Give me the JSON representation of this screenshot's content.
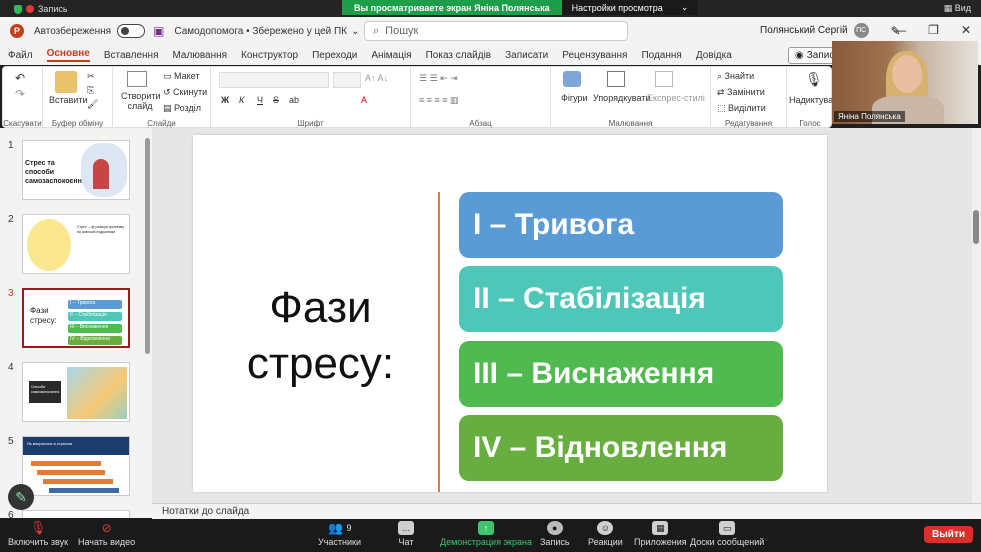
{
  "zoom_top": {
    "record_label": "Запись",
    "banner_text": "Вы просматриваете экран Яніна Полянська",
    "view_options_label": "Настройки просмотра",
    "view_label": "Вид"
  },
  "titlebar": {
    "autosave_label": "Автозбереження",
    "doc_title": "Самодопомога • Збережено у цей ПК",
    "doc_chevron": "⌄",
    "search_placeholder": "Пошук",
    "user_name": "Полянський Сергій",
    "user_initials": "ПС"
  },
  "tabs": [
    "Файл",
    "Основне",
    "Вставлення",
    "Малювання",
    "Конструктор",
    "Переходи",
    "Анімація",
    "Показ слайдів",
    "Записати",
    "Рецензування",
    "Подання",
    "Довідка"
  ],
  "record_button": "Записа",
  "ribbon": {
    "groups": [
      "Скасувати",
      "Буфер обміну",
      "Слайди",
      "Шрифт",
      "Абзац",
      "Малювання",
      "Редагування",
      "Голос"
    ],
    "paste": "Вставити",
    "new_slide": "Створити слайд",
    "layout": "Макет",
    "reset": "Скинути",
    "section": "Розділ",
    "shapes": "Фігури",
    "arrange": "Упорядкувати",
    "quick_styles": "Експрес-стилі",
    "find": "Знайти",
    "replace": "Замінити",
    "select": "Виділити",
    "dictate": "Надиктувати",
    "font_buttons": [
      "Ж",
      "К",
      "Ч",
      "S",
      "ab"
    ]
  },
  "camera": {
    "name": "Яніна Полянська"
  },
  "slides": [
    {
      "num": "1",
      "title": "Стрес та способи самозаспокоєння"
    },
    {
      "num": "2",
      "title": "Стрес – це реакція організму на зовнішні подразники"
    },
    {
      "num": "3",
      "title": "Фази стресу:",
      "items": [
        "I – Тривога",
        "II – Стабілізація",
        "III – Виснаження",
        "IV – Відновлення"
      ]
    },
    {
      "num": "4",
      "title": "Способи самозаспокоєння"
    },
    {
      "num": "5",
      "title": "Як впоратися зі стресом"
    },
    {
      "num": "6",
      "title": ""
    }
  ],
  "current_slide": {
    "title_line1": "Фази",
    "title_line2": "стресу:",
    "phases": [
      {
        "label": "I – Тривога",
        "color": "#5b9bd5"
      },
      {
        "label": "II – Стабілізація",
        "color": "#4fc7b8"
      },
      {
        "label": "III – Виснаження",
        "color": "#50b94f"
      },
      {
        "label": "IV – Відновлення",
        "color": "#68ad3f"
      }
    ],
    "divider_color": "#e07b39"
  },
  "notes_placeholder": "Нотатки до слайда",
  "zoom_toolbar": {
    "mic": "Включить звук",
    "video": "Начать видео",
    "participants": "Участники",
    "participants_count": "9",
    "chat": "Чат",
    "share": "Демонстрация экрана",
    "record": "Запись",
    "reactions": "Реакции",
    "apps": "Приложения",
    "whiteboard": "Доски сообщений",
    "exit": "Выйти"
  }
}
